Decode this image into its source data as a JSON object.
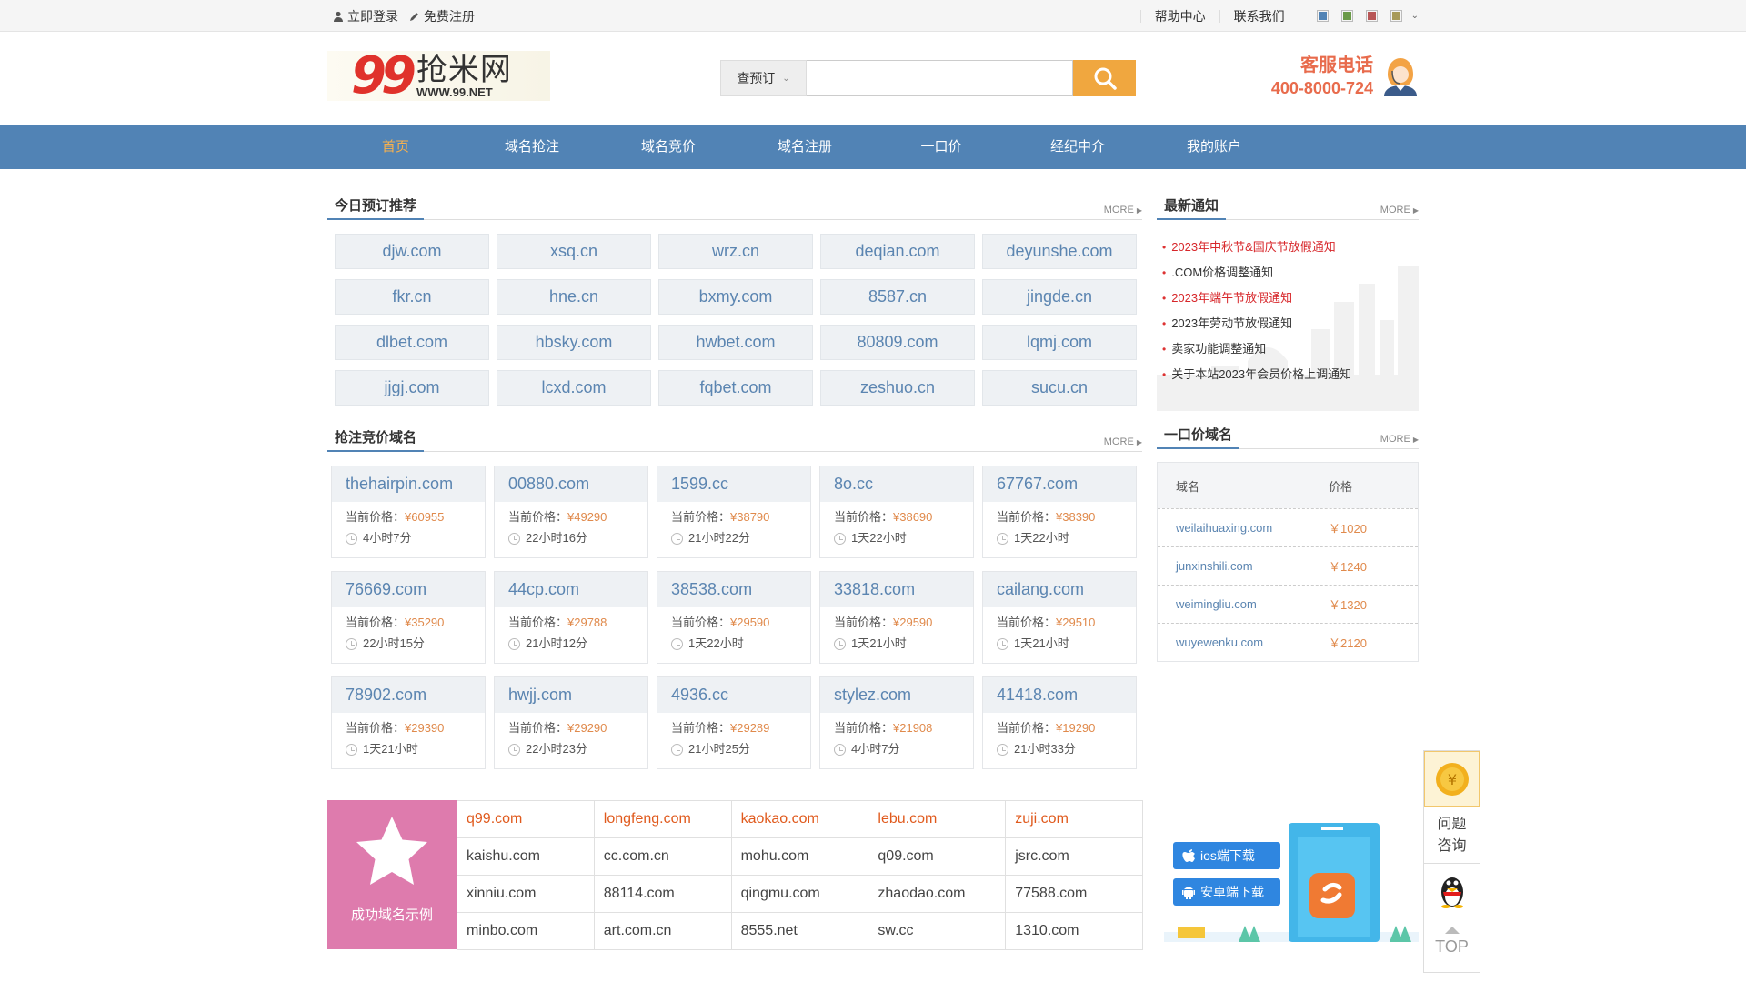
{
  "topbar": {
    "login": "立即登录",
    "register": "免费注册",
    "help": "帮助中心",
    "contact": "联系我们",
    "theme_colors": [
      "#5183b5",
      "#6a9a48",
      "#b85656",
      "#a89a5a"
    ]
  },
  "header": {
    "logo_number": "99",
    "logo_name": "抢米网",
    "logo_url": "WWW.99.NET",
    "search_select": "查预订",
    "search_placeholder": "",
    "hotline_label": "客服电话",
    "hotline_number": "400-8000-724"
  },
  "nav": {
    "items": [
      {
        "label": "首页",
        "active": true
      },
      {
        "label": "域名抢注"
      },
      {
        "label": "域名竞价"
      },
      {
        "label": "域名注册"
      },
      {
        "label": "一口价"
      },
      {
        "label": "经纪中介"
      },
      {
        "label": "我的账户"
      }
    ]
  },
  "today": {
    "title": "今日预订推荐",
    "more": "MORE",
    "domains": [
      "djw.com",
      "xsq.cn",
      "wrz.cn",
      "deqian.com",
      "deyunshe.com",
      "fkr.cn",
      "hne.cn",
      "bxmy.com",
      "8587.cn",
      "jingde.cn",
      "dlbet.com",
      "hbsky.com",
      "hwbet.com",
      "80809.com",
      "lqmj.com",
      "jjgj.com",
      "lcxd.com",
      "fqbet.com",
      "zeshuo.cn",
      "sucu.cn"
    ]
  },
  "notices": {
    "title": "最新通知",
    "more": "MORE",
    "items": [
      {
        "text": "2023年中秋节&国庆节放假通知",
        "red": true
      },
      {
        "text": ".COM价格调整通知",
        "red": false
      },
      {
        "text": "2023年端午节放假通知",
        "red": true
      },
      {
        "text": "2023年劳动节放假通知",
        "red": false
      },
      {
        "text": "卖家功能调整通知",
        "red": false
      },
      {
        "text": "关于本站2023年会员价格上调通知",
        "red": false
      }
    ]
  },
  "auction": {
    "title": "抢注竞价域名",
    "more": "MORE",
    "price_label": "当前价格：",
    "items": [
      {
        "name": "thehairpin.com",
        "price": "¥60955",
        "time": "4小时7分"
      },
      {
        "name": "00880.com",
        "price": "¥49290",
        "time": "22小时16分"
      },
      {
        "name": "1599.cc",
        "price": "¥38790",
        "time": "21小时22分"
      },
      {
        "name": "8o.cc",
        "price": "¥38690",
        "time": "1天22小时"
      },
      {
        "name": "67767.com",
        "price": "¥38390",
        "time": "1天22小时"
      },
      {
        "name": "76669.com",
        "price": "¥35290",
        "time": "22小时15分"
      },
      {
        "name": "44cp.com",
        "price": "¥29788",
        "time": "21小时12分"
      },
      {
        "name": "38538.com",
        "price": "¥29590",
        "time": "1天22小时"
      },
      {
        "name": "33818.com",
        "price": "¥29590",
        "time": "1天21小时"
      },
      {
        "name": "cailang.com",
        "price": "¥29510",
        "time": "1天21小时"
      },
      {
        "name": "78902.com",
        "price": "¥29390",
        "time": "1天21小时"
      },
      {
        "name": "hwjj.com",
        "price": "¥29290",
        "time": "22小时23分"
      },
      {
        "name": "4936.cc",
        "price": "¥29289",
        "time": "21小时25分"
      },
      {
        "name": "stylez.com",
        "price": "¥21908",
        "time": "4小时7分"
      },
      {
        "name": "41418.com",
        "price": "¥19290",
        "time": "21小时33分"
      }
    ]
  },
  "fixed_price": {
    "title": "一口价域名",
    "more": "MORE",
    "col_domain": "域名",
    "col_price": "价格",
    "rows": [
      {
        "domain": "weilaihuaxing.com",
        "price": "￥1020"
      },
      {
        "domain": "junxinshili.com",
        "price": "￥1240"
      },
      {
        "domain": "weimingliu.com",
        "price": "￥1320"
      },
      {
        "domain": "wuyewenku.com",
        "price": "￥2120"
      }
    ]
  },
  "success": {
    "label": "成功域名示例",
    "rows": [
      [
        "q99.com",
        "longfeng.com",
        "kaokao.com",
        "lebu.com",
        "zuji.com"
      ],
      [
        "kaishu.com",
        "cc.com.cn",
        "mohu.com",
        "q09.com",
        "jsrc.com"
      ],
      [
        "xinniu.com",
        "88114.com",
        "qingmu.com",
        "zhaodao.com",
        "77588.com"
      ],
      [
        "minbo.com",
        "art.com.cn",
        "8555.net",
        "sw.cc",
        "1310.com"
      ]
    ]
  },
  "app": {
    "ios": "ios端下载",
    "android": "安卓端下载"
  },
  "floatbar": {
    "coin_symbol": "¥",
    "question_line1": "问题",
    "question_line2": "咨询",
    "top": "TOP"
  }
}
